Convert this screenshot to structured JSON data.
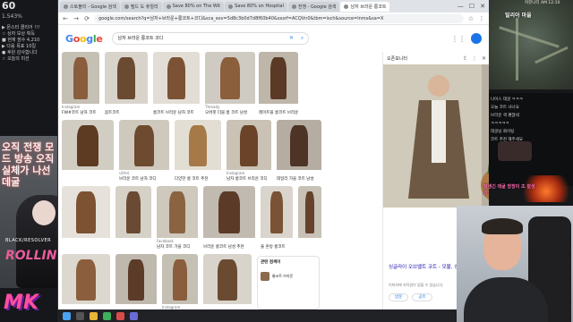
{
  "overlay": {
    "fps": "60",
    "fps_sub": "1.543%",
    "left_texts": [
      "▶ 몬스터 클리어 !!!",
      "☆ 상자 보상 획득",
      "■ 현재 점수 4,210",
      "▶ 다음 목표 10킬",
      "● 후원 감사합니다",
      "☆ 오늘의 미션"
    ],
    "promo_text": "오직 전쟁 모드 방송 오직 실체가 나선 데굴",
    "promo_caption": "BLACK/RESOLVER",
    "promo_name": "ROLLING",
    "logo": "MK"
  },
  "browser": {
    "tabs": [
      {
        "label": "스토블리 - Google 검색",
        "active": false
      },
      {
        "label": "필드 도 쥬얼리",
        "active": false
      },
      {
        "label": "Save 80% on The Wit",
        "active": false
      },
      {
        "label": "Save 80% on Hospital",
        "active": false
      },
      {
        "label": "전쟁 - Google 검색",
        "active": false
      },
      {
        "label": "남자 브라운 롱코트",
        "active": true
      }
    ],
    "window_controls": [
      "—",
      "☐",
      "✕"
    ],
    "url": "google.com/search?q=남자+브라운+롱코트+코디&sca_esv=5d8c3b0d7d8f60b40&sxsrf=ACQVn0&tbm=isch&source=lnms&sa=X",
    "search_query": "남자 브라운 롱코트 코디",
    "logo_letters": [
      "G",
      "o",
      "o",
      "g",
      "l",
      "e"
    ],
    "logo_colors": [
      "#4285f4",
      "#ea4335",
      "#fbbc05",
      "#4285f4",
      "#34a853",
      "#ea4335"
    ]
  },
  "results": [
    {
      "source": "Instagram",
      "title": "FW#코트 남자 코트",
      "color": "#8a5d3c",
      "bg": "#c5c0b4"
    },
    {
      "source": "",
      "title": "봄트코트",
      "color": "#6b4a32",
      "bg": "#d8d4cc"
    },
    {
      "source": "",
      "title": "롱코트 브라운 남자 코트",
      "color": "#7b5234",
      "bg": "#e2ded6"
    },
    {
      "source": "Thready",
      "title": "오버핏 더블 롱 코트 남성",
      "color": "#8b5e3c",
      "bg": "#cfcbc2"
    },
    {
      "source": "",
      "title": "레이트블 롱코트 브라운",
      "color": "#5a3a26",
      "bg": "#bdb6a9"
    },
    {
      "source": "",
      "title": "",
      "color": "#5d3a22",
      "bg": "#d2cdc3"
    },
    {
      "source": "네이버",
      "title": "브라운 코트 남자 코디",
      "color": "#6e4a30",
      "bg": "#cfc9bd"
    },
    {
      "source": "",
      "title": "다양한 롱 코트 추천",
      "color": "#a57a48",
      "bg": "#e3ded3"
    },
    {
      "source": "Instagram",
      "title": "남자 롱코트 브라운 코디",
      "color": "#6a4329",
      "bg": "#c9c2b5"
    },
    {
      "source": "",
      "title": "데일리 가을 코트 남성",
      "color": "#4e3426",
      "bg": "#b5ada1"
    },
    {
      "source": "",
      "title": "",
      "color": "#7c5232",
      "bg": "#e6e2db"
    },
    {
      "source": "",
      "title": "",
      "color": "#6b4a33",
      "bg": "#d6d1c7"
    },
    {
      "source": "Facebook",
      "title": "남자 코트 가을 코디",
      "color": "#8a6440",
      "bg": "#cec8bd"
    },
    {
      "source": "",
      "title": "브라운 롱코트 남성 추천",
      "color": "#5b3b27",
      "bg": "#c1bab0"
    },
    {
      "source": "",
      "title": "울 혼방 롱코트",
      "color": "#7a5235",
      "bg": "#dad5cc"
    },
    {
      "source": "",
      "title": "",
      "color": "#65422c",
      "bg": "#c8c1b6"
    },
    {
      "source": "",
      "title": "",
      "color": "#8b5f3d",
      "bg": "#ddd8cf"
    },
    {
      "source": "",
      "title": "",
      "color": "#5c3b28",
      "bg": "#bfb8ad"
    }
  ],
  "side_panel": {
    "source": "오픈모니터",
    "title": "싱글라이 오브밸트 코트 - 모뷸, 싱글라이 오브밸트 코트 - 모뷸",
    "note": "이미지에 저작권이 있을 수 있습니다.",
    "buttons": [
      "방문",
      "공유"
    ],
    "related_title": "관련 검색어",
    "related_item": "롱코트 브라운",
    "image_colors": {
      "coat": "#6e5a44",
      "bg": "#cfcab9",
      "wall": "#b8b1a3"
    }
  },
  "right_column": {
    "map_title": "빌리아 마을",
    "time": "커뮤니티 AM 12:10",
    "chat": [
      "나이스 데굴 ㅋㅋㅋ",
      "오늘 코트 사나요",
      "브라운 색 괜찮네",
      "ㅋㅋㅋㅋㅋ",
      "데굴님 화이팅",
      "코트 추천 해주세요"
    ],
    "cam_caption": "잘생긴 데굴 방장이 초 잘생김"
  }
}
